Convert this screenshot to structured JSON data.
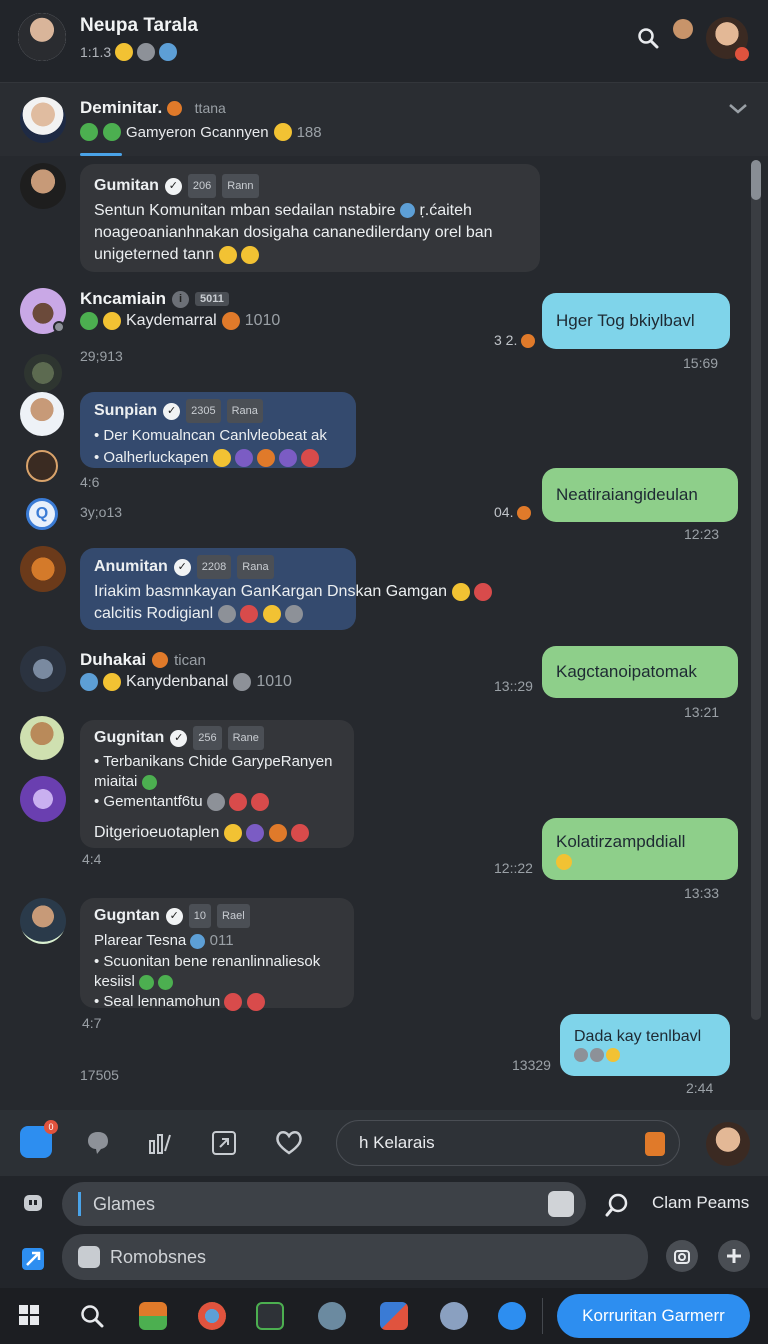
{
  "top_header": {
    "name": "Neupa Tarala",
    "sub": "1:1.3",
    "search_icon": "search-icon"
  },
  "channel_header": {
    "name": "Deminitar.",
    "tag": "ttana",
    "sub": "Gamyeron Gcannyen",
    "count": "188"
  },
  "messages": [
    {
      "author": "Gumitan",
      "chip1": "206",
      "chip2": "Rann",
      "lines": [
        "Sentun Komunitan mban sedailan nstabire",
        "noageoanianhnakan dosigaha cananedilerdany orel ban",
        "unigeterned tann"
      ],
      "tail": "ṛ.ćaiteh"
    },
    {
      "author": "Kncamiain",
      "chip1": "5011",
      "sub": "Kaydemarral",
      "sub_num": "1010",
      "time": "29;913"
    },
    {
      "out_text": "Hger Tog bkiylbavl",
      "prefix": "3 2.",
      "time": "15:69"
    },
    {
      "author": "Sunpian",
      "chip1": "2305",
      "chip2": "Rana",
      "items": [
        "Der Komualncan Canlvleobeat ak",
        "Oalherluckapen"
      ],
      "time": "4:6",
      "time2": "3y;o13"
    },
    {
      "out_text": "Neatiraiangideulan",
      "prefix": "04.",
      "time": "12:23"
    },
    {
      "author": "Anumitan",
      "chip1": "2208",
      "chip2": "Rana",
      "lines": [
        "Iriakim basmnkayan GanKargan Dnskan Gamgan",
        "calcitis Rodigianl"
      ]
    },
    {
      "author": "Duhakai",
      "tag": "tican",
      "sub": "Kanydenbanal",
      "sub_num": "1010",
      "time": "13::29"
    },
    {
      "out_text": "Kagctanoipatomak",
      "time": "13:21"
    },
    {
      "author": "Gugnitan",
      "chip1": "256",
      "chip2": "Rane",
      "items": [
        "Terbanikans Chide GarypeRanyen miaitai",
        "Gementantf6tu"
      ],
      "line": "Ditgerioeuotaplen",
      "time": "4:4"
    },
    {
      "out_text": "Kolatirzampddiall",
      "prefix": "12::22",
      "time": "13:33"
    },
    {
      "author": "Gugntan",
      "chip1": "10",
      "chip2": "Rael",
      "first": "Plarear Tesna",
      "first_tail": "011",
      "items": [
        "Scuonitan bene renanlinnaliesok kesiisl",
        "Seal lennamohun"
      ],
      "time": "4:7",
      "time2": "17505"
    },
    {
      "out_text": "Dada kay tenlbavl",
      "prefix": "13329",
      "time": "2:44"
    }
  ],
  "action_bar": {
    "input_text": "h Kelarais",
    "badge": "0"
  },
  "search": {
    "row1_text": "Glames",
    "row1_right": "Clam Peams",
    "row2_text": "Romobsnes"
  },
  "taskbar": {
    "community_button": "Korruritan Garmerr"
  },
  "colors": {
    "accent": "#2d8ef0",
    "bubble_cyan": "#7fd4ea",
    "bubble_green": "#8ecf8a",
    "bubble_blue": "#344a6e"
  }
}
